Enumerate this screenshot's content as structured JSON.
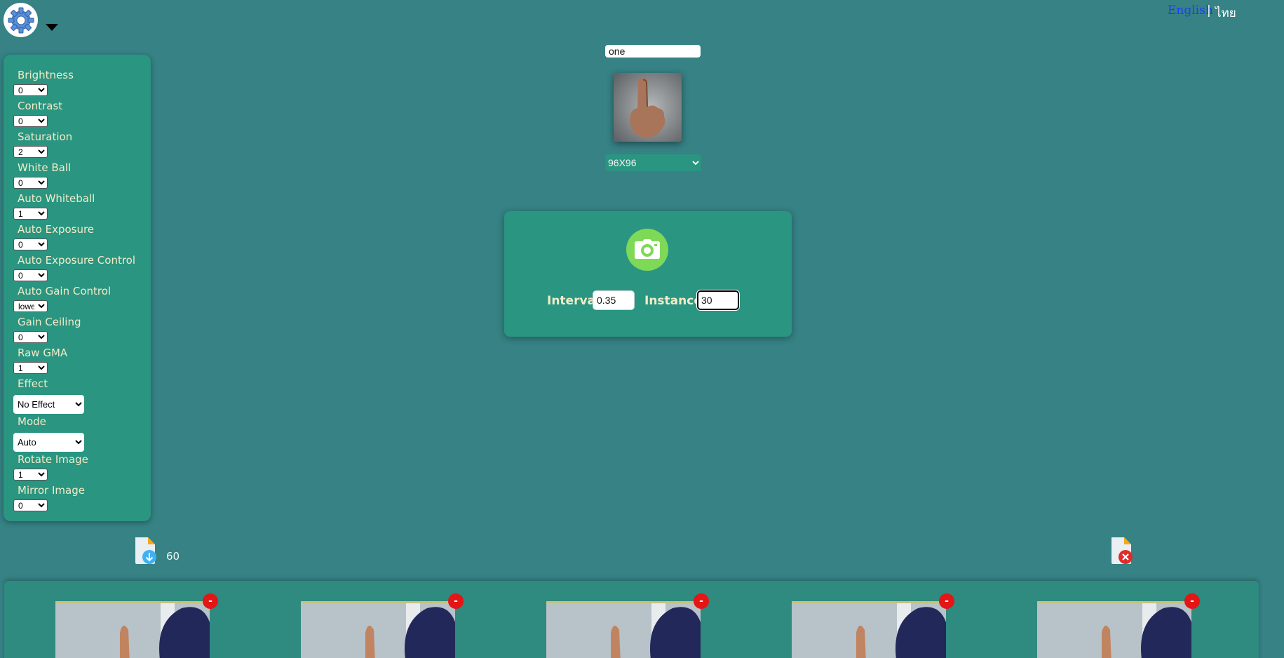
{
  "header": {
    "settings_icon": "gear-icon",
    "menu_icon": "caret-down-icon",
    "lang_english": "English",
    "lang_separator": "|",
    "lang_thai": "ไทย"
  },
  "settings": {
    "brightness": {
      "label": "Brightness",
      "value": "0"
    },
    "contrast": {
      "label": "Contrast",
      "value": "0"
    },
    "saturation": {
      "label": "Saturation",
      "value": "2"
    },
    "white_ball": {
      "label": "White Ball",
      "value": "0"
    },
    "auto_whiteball": {
      "label": "Auto Whiteball",
      "value": "1"
    },
    "auto_exposure": {
      "label": "Auto Exposure",
      "value": "0"
    },
    "auto_exposure_control": {
      "label": "Auto Exposure Control",
      "value": "0"
    },
    "auto_gain_control": {
      "label": "Auto Gain Control",
      "value": "lowe"
    },
    "gain_ceiling": {
      "label": "Gain Ceiling",
      "value": "0"
    },
    "raw_gma": {
      "label": "Raw GMA",
      "value": "1"
    },
    "effect": {
      "label": "Effect",
      "value": "No Effect"
    },
    "mode": {
      "label": "Mode",
      "value": "Auto"
    },
    "rotate_image": {
      "label": "Rotate Image",
      "value": "1"
    },
    "mirror_image": {
      "label": "Mirror Image",
      "value": "0"
    }
  },
  "capture": {
    "class_name": "one",
    "resolution": "96X96",
    "camera_icon": "camera-icon",
    "interval_label": "Interval",
    "interval_value": "0.35",
    "instances_label": "Instances",
    "instances_value": "30"
  },
  "dataset": {
    "download_icon": "download-file-icon",
    "count": "60",
    "delete_icon": "delete-file-icon",
    "remove_label": "-",
    "thumbnail_count": 5
  },
  "colors": {
    "background": "#368285",
    "panel": "#2a9581",
    "label": "#f2ecc8",
    "camera_button": "#7ed957",
    "remove_button": "#e31515",
    "link": "#1f3cff"
  }
}
